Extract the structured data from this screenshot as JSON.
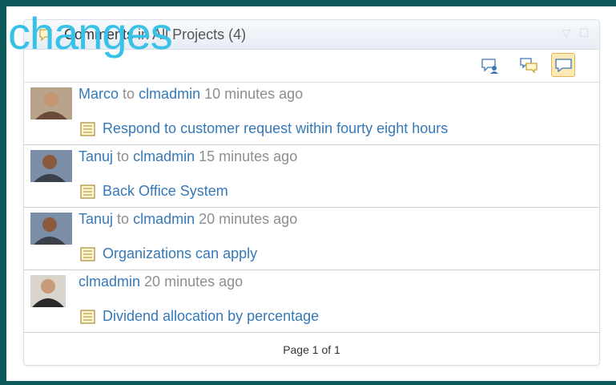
{
  "widget": {
    "title_main": "Comments",
    "title_scope": "in All Projects (4)"
  },
  "toolbar": {
    "buttons": [
      {
        "icon": "comment-user-icon",
        "active": false
      },
      {
        "icon": "comments-icon",
        "active": false
      },
      {
        "icon": "comment-icon",
        "active": true
      }
    ]
  },
  "comments": [
    {
      "author": "Marco",
      "to_word": "to",
      "recipient": "clmadmin",
      "time": "10 minutes ago",
      "work_item": "Respond to customer request within fourty eight hours"
    },
    {
      "author": "Tanuj",
      "to_word": "to",
      "recipient": "clmadmin",
      "time": "15 minutes ago",
      "work_item": "Back Office System"
    },
    {
      "author": "Tanuj",
      "to_word": "to",
      "recipient": "clmadmin",
      "time": "20 minutes ago",
      "work_item": "Organizations can apply"
    },
    {
      "author": "clmadmin",
      "to_word": "",
      "recipient": "",
      "time": "20 minutes ago",
      "work_item": "Dividend allocation by percentage"
    }
  ],
  "pager": {
    "label": "Page 1 of 1"
  },
  "overlay": {
    "text": "changes"
  },
  "colors": {
    "frame": "#0d5a5c",
    "link": "#3579b8",
    "overlay": "#38c2e7",
    "active_button": "#fde9b6"
  }
}
